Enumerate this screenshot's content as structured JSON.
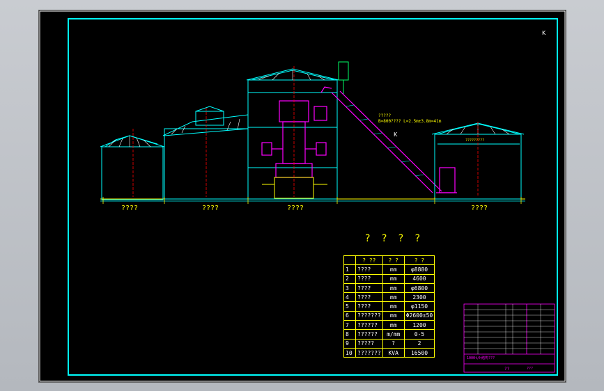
{
  "section_labels": [
    "????",
    "????",
    "????",
    "????"
  ],
  "belt_annotation_1": "?????",
  "belt_annotation_2": "B=800???? L=2.5m±3.8m=41m",
  "roof_annotation": "?????????",
  "table_title": "? ? ? ?",
  "table": {
    "headers": [
      "",
      "? ??",
      "? ?",
      "? ?"
    ],
    "rows": [
      [
        "1",
        "????",
        "mm",
        "φ8880"
      ],
      [
        "2",
        "????",
        "mm",
        "4600"
      ],
      [
        "3",
        "????",
        "mm",
        "φ6800"
      ],
      [
        "4",
        "????",
        "mm",
        "2300"
      ],
      [
        "5",
        "????",
        "mm",
        "φ1150"
      ],
      [
        "6",
        "???????",
        "mm",
        "Φ2600±50"
      ],
      [
        "7",
        "??????",
        "mm",
        "1200"
      ],
      [
        "8",
        "??????",
        "m/mm",
        "0-5"
      ],
      [
        "9",
        "?????",
        "?",
        "2"
      ],
      [
        "10",
        "???????",
        "KVA",
        "16500"
      ]
    ]
  },
  "title_block": {
    "drawing_name": "1000t/h结构???",
    "sheet_code": "??",
    "note": "???"
  },
  "corner_marks": [
    "K",
    "K"
  ],
  "colors": {
    "background": "#000000",
    "border": "#00ffff",
    "text": "#ffff00",
    "structure": "#00ffff",
    "equipment": "#ff00ff",
    "axis": "#ff0000"
  }
}
